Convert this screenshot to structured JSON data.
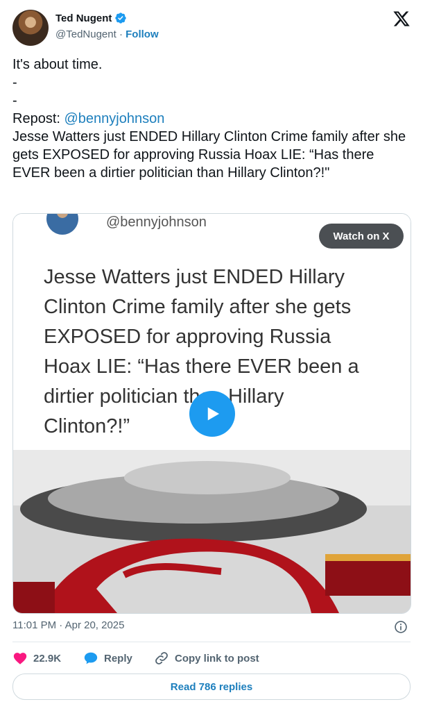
{
  "author": {
    "name": "Ted Nugent",
    "handle": "@TedNugent",
    "separator": "·",
    "follow_label": "Follow"
  },
  "tweet": {
    "lines": [
      "It's about time.",
      "-",
      "-"
    ],
    "repost_prefix": "Repost: ",
    "repost_mention": "@bennyjohnson",
    "body": "Jesse Watters just ENDED Hillary Clinton Crime family after she gets EXPOSED for approving Russia Hoax LIE: “Has there EVER been a dirtier politician than Hillary Clinton?!\""
  },
  "media": {
    "handle": "@bennyjohnson",
    "quote_lines": [
      "Jesse Watters just ENDED Hillary",
      "Clinton Crime family after she gets",
      "EXPOSED for approving Russia",
      "Hoax LIE: “Has there EVER been a",
      "dirtier politician than Hillary",
      "Clinton?!”"
    ],
    "watch_label": "Watch on X"
  },
  "meta": {
    "timestamp": "11:01 PM · Apr 20, 2025"
  },
  "actions": {
    "like_count": "22.9K",
    "reply_label": "Reply",
    "copy_link_label": "Copy link to post",
    "read_replies_label": "Read 786 replies"
  },
  "icons": {
    "verified": "verified-badge-icon",
    "brand": "x-logo-icon",
    "info": "info-icon",
    "like": "heart-icon",
    "reply": "speech-bubble-icon",
    "copy": "link-icon",
    "play": "play-icon"
  },
  "colors": {
    "accent": "#1d9bf0",
    "link": "#1d7fbd",
    "like": "#f91880",
    "muted": "#536471"
  }
}
